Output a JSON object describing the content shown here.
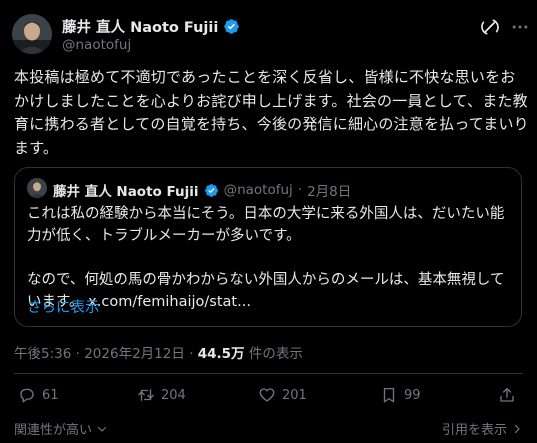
{
  "author": {
    "display_name": "藤井 直人 Naoto Fujii",
    "handle": "@naotofuj"
  },
  "post": {
    "text": "本投稿は極めて不適切であったことを深く反省し、皆様に不快な思いをおかけしましたことを心よりお詫び申し上げます。社会の一員として、また教育に携わる者としての自覚を持ち、今後の発信に細心の注意を払ってまいります。"
  },
  "quote": {
    "display_name": "藤井 直人 Naoto Fujii",
    "handle": "@naotofuj",
    "separator": "·",
    "date": "2月8日",
    "paragraph1": "これは私の経験から本当にそう。日本の大学に来る外国人は、だいたい能力が低く、トラブルメーカーが多いです。",
    "paragraph2": "なので、何処の馬の骨かわからない外国人からのメールは、基本無視しています。",
    "link": "x.com/femihaijo/stat...",
    "show_more": "さらに表示"
  },
  "meta": {
    "time": "午後5:36",
    "separator": "·",
    "date": "2026年2月12日",
    "views_count": "44.5万",
    "views_label": "件の表示"
  },
  "actions": {
    "replies": "61",
    "reposts": "204",
    "likes": "201",
    "bookmarks": "99"
  },
  "footer": {
    "sort_label": "関連性が高い",
    "quotes_label": "引用を表示"
  },
  "colors": {
    "background": "#000000",
    "text": "#e7e9ea",
    "muted": "#71767b",
    "accent": "#1d9bf0",
    "border": "#2f3336"
  }
}
